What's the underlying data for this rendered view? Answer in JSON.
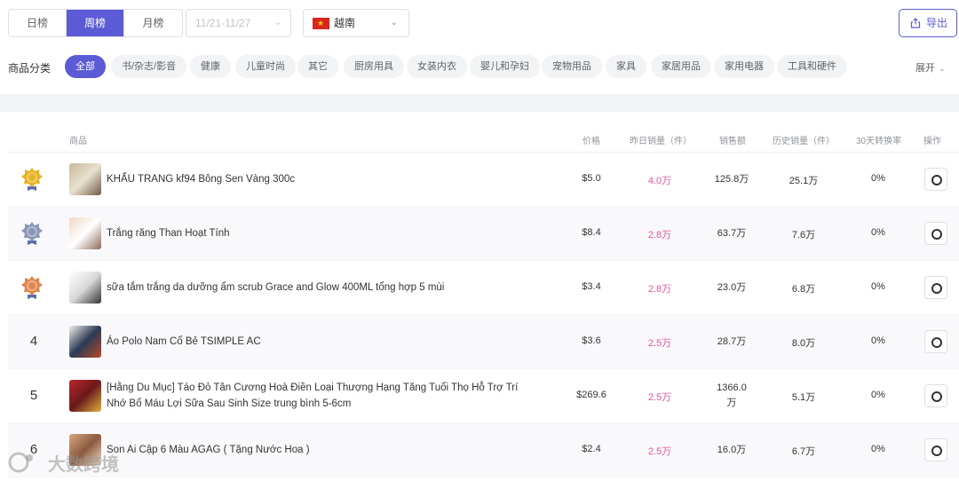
{
  "period_tabs": [
    {
      "label": "日榜",
      "active": false
    },
    {
      "label": "周榜",
      "active": true
    },
    {
      "label": "月榜",
      "active": false
    }
  ],
  "date_range": {
    "placeholder": "11/21-11/27"
  },
  "country": {
    "label": "越南",
    "flag": "vietnam-flag-icon"
  },
  "export_label": "导出",
  "categories": {
    "label": "商品分类",
    "items": [
      "全部",
      "书/杂志/影音",
      "健康",
      "儿童时尚",
      "其它",
      "厨房用具",
      "女装内衣",
      "婴儿和孕妇",
      "宠物用品",
      "家具",
      "家居用品",
      "家用电器",
      "工具和硬件"
    ],
    "active_index": 0,
    "expand_label": "展开"
  },
  "table": {
    "columns": {
      "product": "商品",
      "price": "价格",
      "yesterday_sales": "昨日销量（件）",
      "revenue": "销售额",
      "history_sales": "历史销量（件）",
      "conversion": "30天转换率",
      "action": "操作"
    },
    "rows": [
      {
        "rank": "1",
        "medal": "gold-medal-icon",
        "title_lines": [
          "KHẨU TRANG kf94 Bông Sen Vàng 300c"
        ],
        "price": "$5.0",
        "yesterday_sales": "4.0万",
        "revenue_lines": [
          "125.8万"
        ],
        "history_sales": "25.1万",
        "conversion": "0%"
      },
      {
        "rank": "2",
        "medal": "silver-medal-icon",
        "title_lines": [
          "Trắng răng Than Hoạt Tính"
        ],
        "price": "$8.4",
        "yesterday_sales": "2.8万",
        "revenue_lines": [
          "63.7万"
        ],
        "history_sales": "7.6万",
        "conversion": "0%"
      },
      {
        "rank": "3",
        "medal": "bronze-medal-icon",
        "title_lines": [
          "sữa tắm trắng da dưỡng ẩm scrub Grace and Glow 400ML tổng hợp 5 mùi"
        ],
        "price": "$3.4",
        "yesterday_sales": "2.8万",
        "revenue_lines": [
          "23.0万"
        ],
        "history_sales": "6.8万",
        "conversion": "0%"
      },
      {
        "rank": "4",
        "medal": "",
        "title_lines": [
          "Áo Polo Nam Cổ Bẻ TSIMPLE AC"
        ],
        "price": "$3.6",
        "yesterday_sales": "2.5万",
        "revenue_lines": [
          "28.7万"
        ],
        "history_sales": "8.0万",
        "conversion": "0%"
      },
      {
        "rank": "5",
        "medal": "",
        "title_lines": [
          "[Hằng Du Mục] Táo Đỏ Tân Cương Hoà Điền Loại Thượng Hạng Tăng Tuổi Thọ Hỗ Trợ Trí",
          "Nhớ Bổ Máu Lợi Sữa Sau Sinh Size trung bình 5-6cm"
        ],
        "price": "$269.6",
        "yesterday_sales": "2.5万",
        "revenue_lines": [
          "1366.0",
          "万"
        ],
        "history_sales": "5.1万",
        "conversion": "0%"
      },
      {
        "rank": "6",
        "medal": "",
        "title_lines": [
          "Son Ai Cập 6 Màu AGAG ( Tặng Nước Hoa )"
        ],
        "price": "$2.4",
        "yesterday_sales": "2.5万",
        "revenue_lines": [
          "16.0万"
        ],
        "history_sales": "6.7万",
        "conversion": "0%"
      }
    ]
  },
  "watermark": "大数跨境",
  "colors": {
    "accent": "#5b5bd6",
    "sales_pink": "#e6539c",
    "gold": "#e6b422",
    "silver": "#8a97b8",
    "bronze": "#e0874f"
  }
}
